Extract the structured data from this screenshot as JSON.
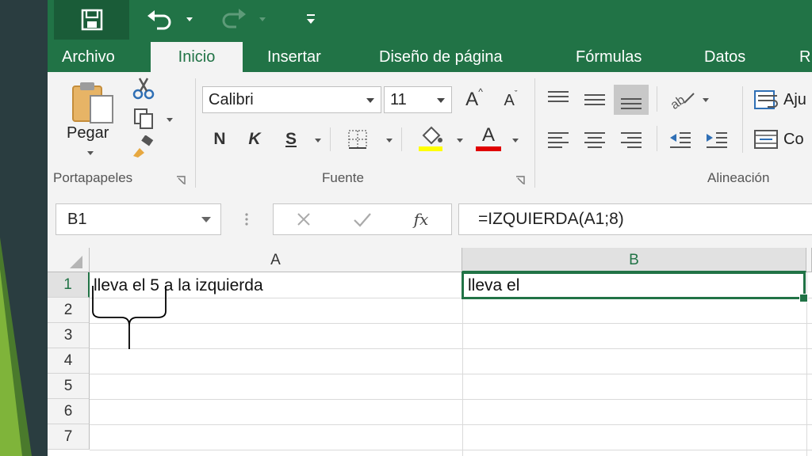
{
  "quick_access": {
    "save": "save-icon",
    "undo": "undo-icon",
    "redo": "redo-icon",
    "customize": "customize-qat-icon"
  },
  "tabs": [
    {
      "label": "Archivo",
      "active": false
    },
    {
      "label": "Inicio",
      "active": true
    },
    {
      "label": "Insertar",
      "active": false
    },
    {
      "label": "Diseño de página",
      "active": false
    },
    {
      "label": "Fórmulas",
      "active": false
    },
    {
      "label": "Datos",
      "active": false
    },
    {
      "label": "R",
      "active": false
    }
  ],
  "ribbon": {
    "clipboard": {
      "label": "Portapapeles",
      "paste_label": "Pegar"
    },
    "font": {
      "label": "Fuente",
      "font_name": "Calibri",
      "font_size": "11",
      "bold": "N",
      "italic": "K",
      "underline": "S",
      "grow_letter": "A",
      "shrink_letter": "A",
      "font_color_letter": "A",
      "fill_color": "#ffff00",
      "font_color": "#e00000"
    },
    "alignment": {
      "label": "Alineación",
      "wrap_label": "Aju",
      "merge_label": "Co"
    }
  },
  "formula_bar": {
    "name_box": "B1",
    "cancel_icon": "cancel-icon",
    "enter_icon": "check-icon",
    "fx_label": "fx",
    "formula": "=IZQUIERDA(A1;8)"
  },
  "sheet": {
    "columns": [
      "A",
      "B"
    ],
    "rows": [
      "1",
      "2",
      "3",
      "4",
      "5",
      "6",
      "7"
    ],
    "cells": {
      "A1": "lleva el 5 a la izquierda",
      "B1": "lleva el"
    },
    "selected_cell": "B1"
  },
  "colors": {
    "accent": "#217346",
    "accent_dark": "#1a5c38",
    "ribbon_bg": "#f3f3f3",
    "slide_green": "#7fb43a",
    "slide_dark": "#2a3d40"
  }
}
